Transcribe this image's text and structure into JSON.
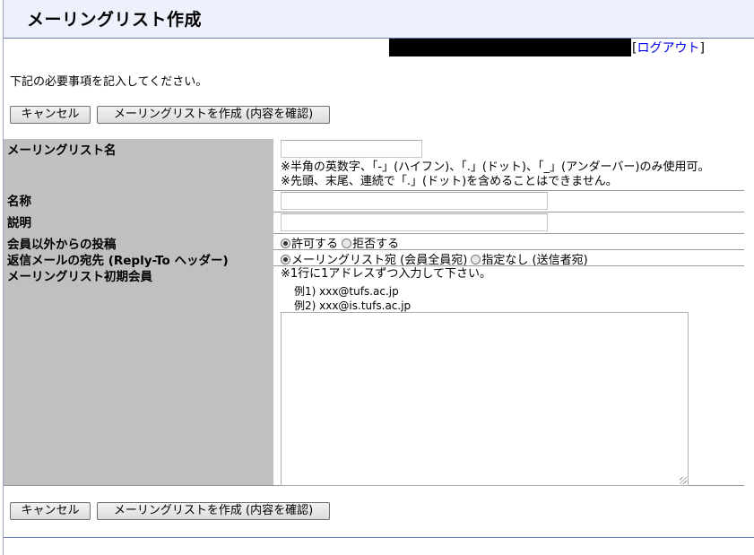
{
  "header": {
    "title": "メーリングリスト作成"
  },
  "user_bar": {
    "logout_prefix": "[",
    "logout_label": "ログアウト",
    "logout_suffix": "]"
  },
  "intro_text": "下記の必要事項を記入してください。",
  "buttons": {
    "cancel": "キャンセル",
    "create": "メーリングリストを作成 (内容を確認)"
  },
  "form": {
    "ml_name": {
      "label": "メーリングリスト名",
      "value": "",
      "note1": "※半角の英数字、「-」(ハイフン)、「.」(ドット)、「_」(アンダーバー)のみ使用可。",
      "note2": "※先頭、末尾、連続で「.」(ドット)を含めることはできません。"
    },
    "display_name": {
      "label": "名称",
      "value": ""
    },
    "description": {
      "label": "説明",
      "value": ""
    },
    "posting": {
      "label": "会員以外からの投稿",
      "options": [
        "許可する",
        "拒否する"
      ],
      "selected": "許可する"
    },
    "reply_to": {
      "label": "返信メールの宛先 (Reply-To ヘッダー)",
      "options": [
        "メーリングリスト宛 (会員全員宛)",
        "指定なし (送信者宛)"
      ],
      "selected": "メーリングリスト宛 (会員全員宛)"
    },
    "initial_members": {
      "label": "メーリングリスト初期会員",
      "note": "※1行に1アドレスずつ入力して下さい。",
      "example1": "例1) xxx@tufs.ac.jp",
      "example2": "例2) xxx@is.tufs.ac.jp",
      "value": ""
    }
  }
}
